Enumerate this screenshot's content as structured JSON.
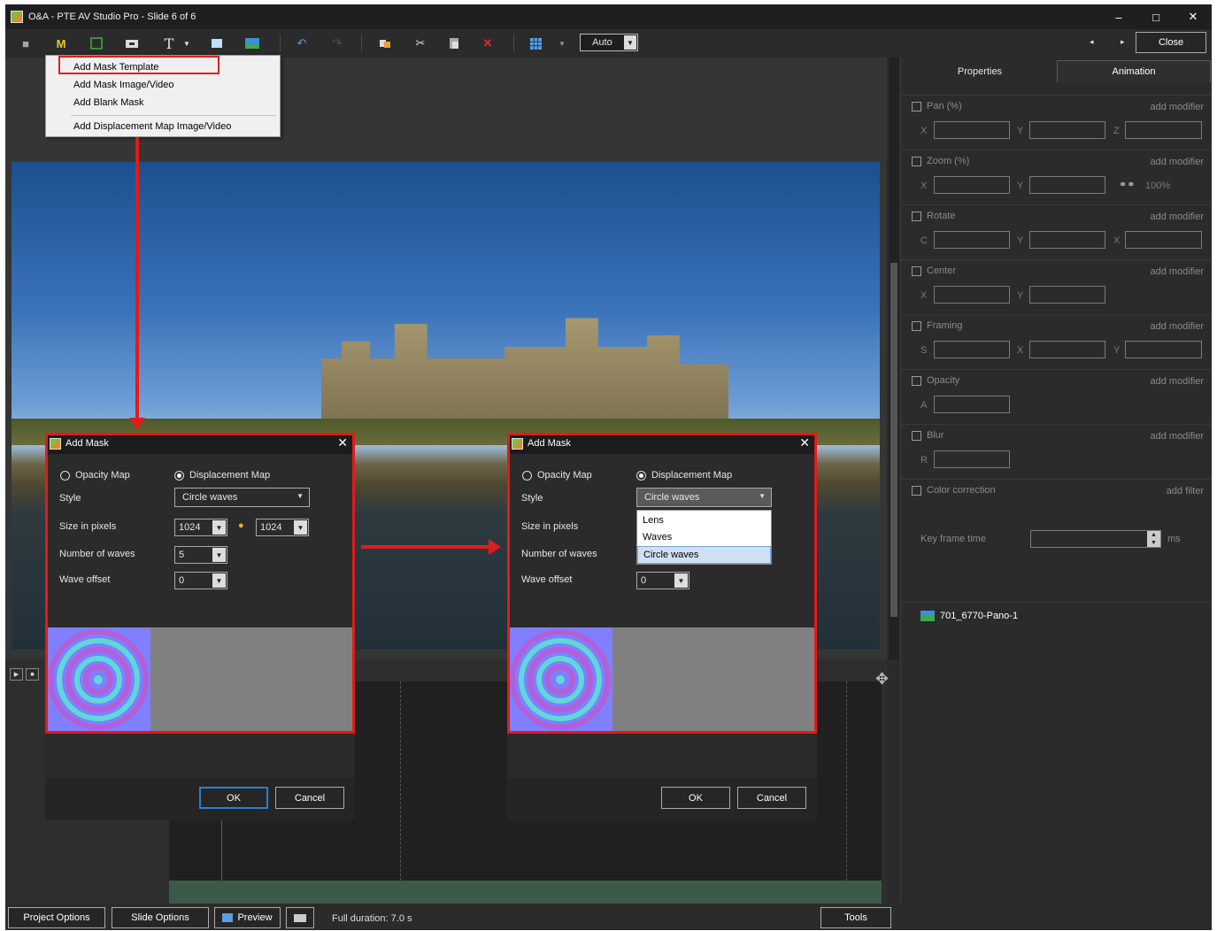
{
  "window": {
    "title": "O&A - PTE AV Studio Pro - Slide 6 of 6",
    "min": "–",
    "max": "□",
    "close": "✕"
  },
  "toolbar": {
    "mask_label": "M",
    "text_label": "T",
    "auto_value": "Auto",
    "close_label": "Close",
    "nav": "◂ ▸"
  },
  "menu": {
    "items": [
      "Add Mask Template",
      "Add Mask Image/Video",
      "Add Blank Mask",
      "Add Displacement Map Image/Video"
    ]
  },
  "tabs": {
    "properties": "Properties",
    "animation": "Animation"
  },
  "props": {
    "pan": "Pan (%)",
    "zoom": "Zoom (%)",
    "rotate": "Rotate",
    "center": "Center",
    "framing": "Framing",
    "opacity": "Opacity",
    "blur": "Blur",
    "color": "Color correction",
    "add_modifier": "add modifier",
    "add_filter": "add filter",
    "x": "X",
    "y": "Y",
    "z": "Z",
    "c": "C",
    "s": "S",
    "a": "A",
    "r": "R",
    "zoom_link": "100%",
    "keyframe_label": "Key frame time",
    "keyframe_unit": "ms"
  },
  "objects": {
    "item": "701_6770-Pano-1"
  },
  "status": {
    "project_options": "Project Options",
    "slide_options": "Slide Options",
    "preview": "Preview",
    "duration": "Full duration: 7.0 s",
    "tools": "Tools"
  },
  "dialog": {
    "title": "Add Mask",
    "opacity_map": "Opacity Map",
    "displacement_map": "Displacement Map",
    "style_label": "Style",
    "style_value": "Circle waves",
    "size_label": "Size in pixels",
    "size_w": "1024",
    "size_h": "1024",
    "waves_label": "Number of waves",
    "waves_value": "5",
    "offset_label": "Wave offset",
    "offset_value": "0",
    "ok": "OK",
    "cancel": "Cancel",
    "style_options": [
      "Lens",
      "Waves",
      "Circle waves"
    ]
  },
  "colors": {
    "highlight": "#e01b1b",
    "accent": "#2a7fd4",
    "panel": "#2b2b2b"
  }
}
